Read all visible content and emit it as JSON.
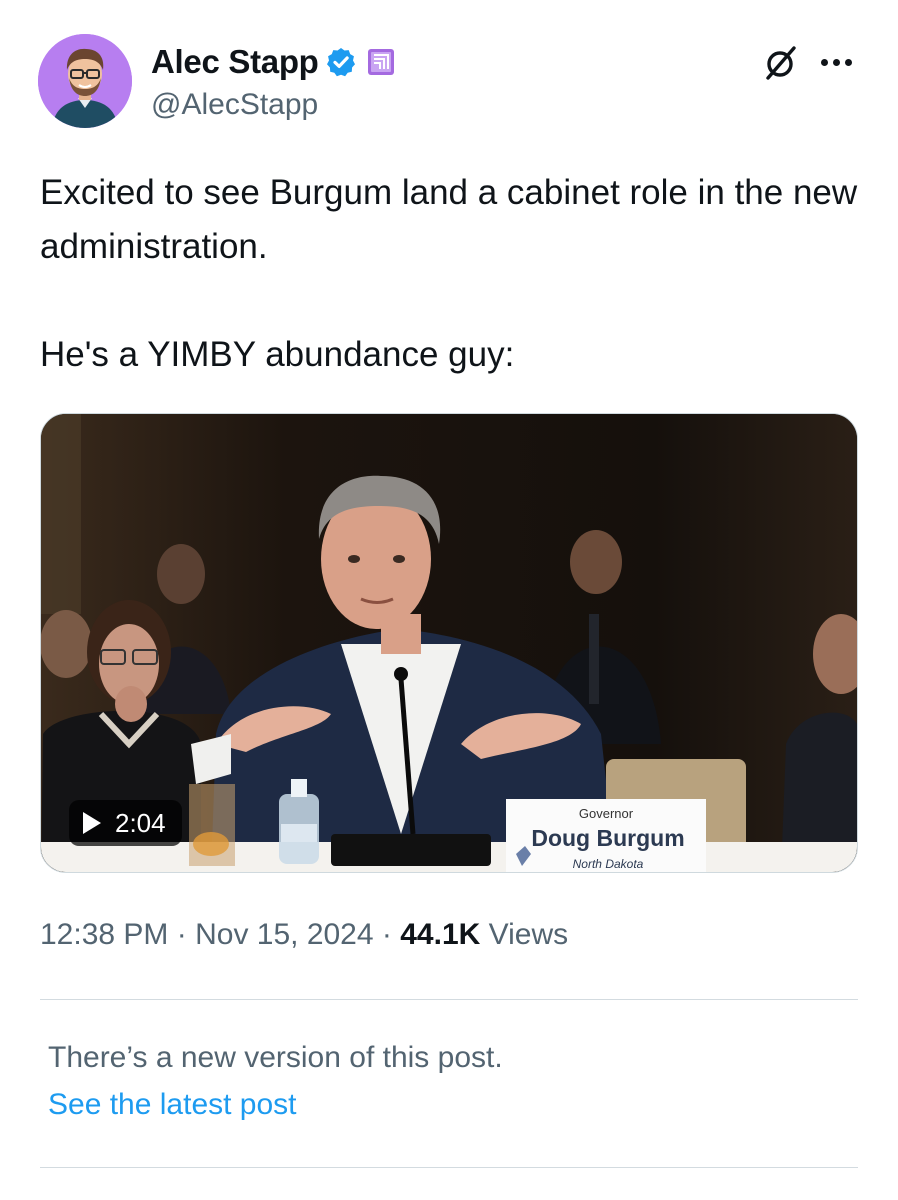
{
  "author": {
    "display_name": "Alec Stapp",
    "handle": "@AlecStapp",
    "verified_color": "#1d9bf0",
    "affiliation_color": "#a46ae0",
    "avatar_bg": "#b77ef0"
  },
  "tweet": {
    "paragraphs": [
      "Excited to see Burgum land a cabinet role in the new administration.",
      "He's a YIMBY abundance guy:"
    ]
  },
  "media": {
    "duration": "2:04",
    "nameplate": {
      "title": "Governor",
      "name": "Doug Burgum",
      "state": "North Dakota"
    }
  },
  "meta": {
    "time": "12:38 PM",
    "separator": " · ",
    "date": "Nov 15, 2024",
    "views_count": "44.1K",
    "views_label": " Views"
  },
  "notice": {
    "text": "There’s a new version of this post.",
    "link": "See the latest post"
  },
  "icons": [
    "verified-icon",
    "affiliation-badge-icon",
    "grok-icon",
    "more-icon",
    "play-icon"
  ]
}
